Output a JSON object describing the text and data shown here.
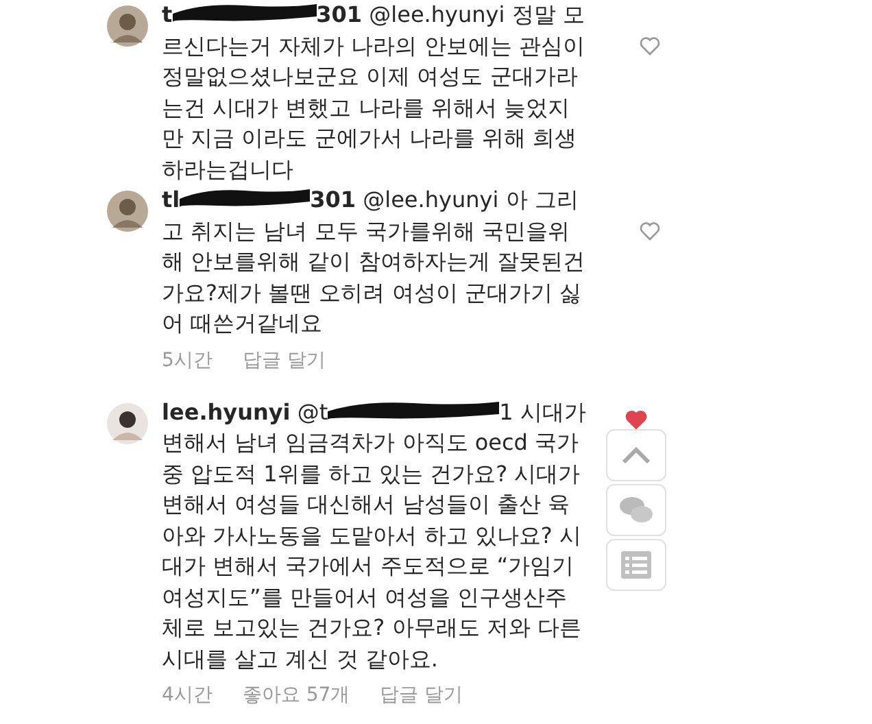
{
  "comments": [
    {
      "username_start": "t",
      "username_end": "301",
      "mention": "@lee.hyunyi",
      "lines": [
        "정말 모",
        "르신다는거 자체가 나라의 안보에는 관심이",
        "정말없으셨나보군요 이제 여성도 군대가라",
        "는건 시대가 변했고 나라를 위해서 늦었지",
        "만 지금 이라도 군에가서 나라를 위해 희생",
        "하라는겁니다"
      ],
      "liked": false
    },
    {
      "username_start": "tl",
      "username_end": "301",
      "mention": "@lee.hyunyi",
      "lines": [
        "아 그리",
        "고 취지는 남녀 모두 국가를위해 국민을위",
        "해 안보를위해 같이 참여하자는게 잘못된건",
        "가요?제가 볼땐 오히려 여성이 군대가기 싫",
        "어 때쓴거같네요"
      ],
      "liked": false,
      "meta": [
        "5시간",
        "답글 달기"
      ]
    },
    {
      "username": "lee.hyunyi",
      "mention_start": "@t",
      "mention_end": "1",
      "lines": [
        "시대가",
        "변해서 남녀 임금격차가 아직도 oecd 국가",
        "중 압도적 1위를 하고 있는 건가요? 시대가",
        "변해서 여성들 대신해서 남성들이 출산 육",
        "아와 가사노동을 도맡아서 하고 있나요? 시",
        "대가 변해서 국가에서 주도적으로 “가임기",
        "여성지도”를 만들어서 여성을 인구생산주",
        "체로 보고있는 건가요? 아무래도 저와 다른",
        "시대를 살고 계신 것 같아요."
      ],
      "liked": true,
      "meta": [
        "4시간",
        "좋아요 57개",
        "답글 달기"
      ],
      "actions": true
    }
  ]
}
